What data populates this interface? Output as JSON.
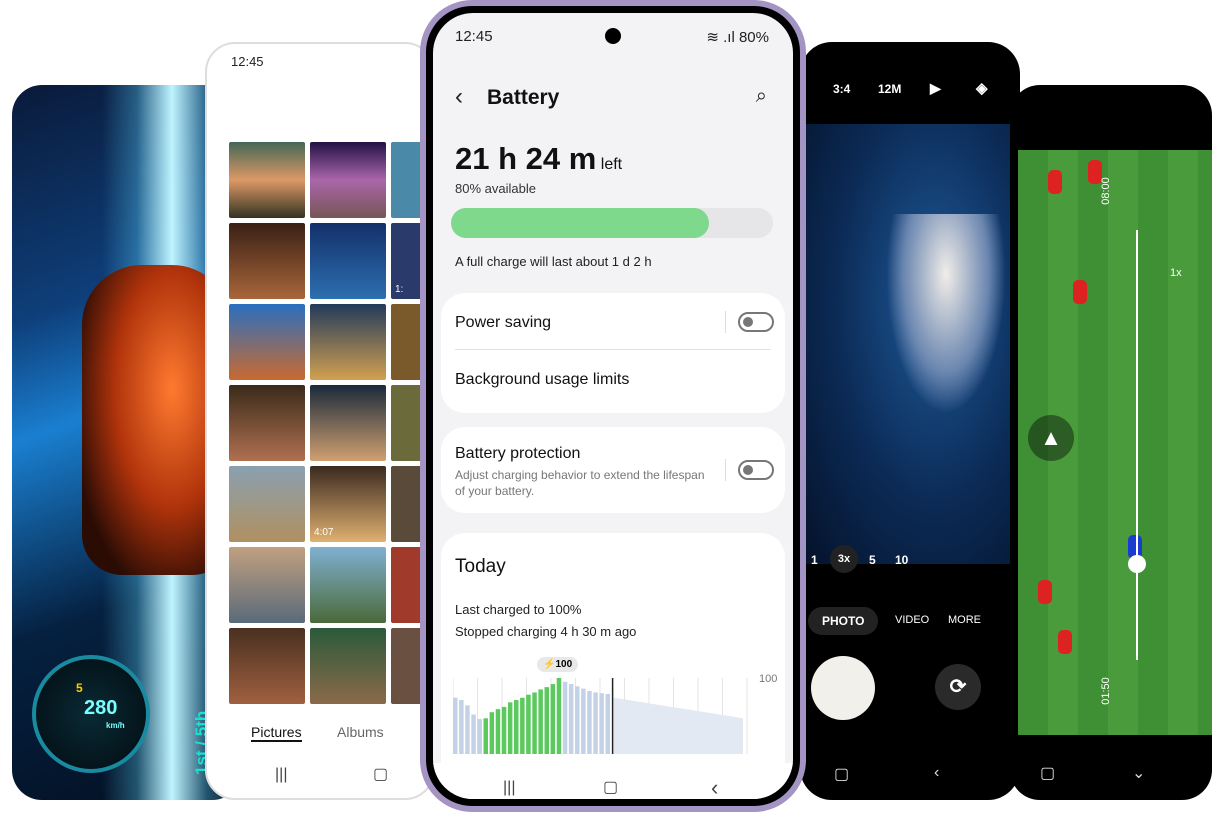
{
  "game": {
    "speed": "280",
    "unit": "km/h",
    "gear": "5",
    "rank": "1st / 5th"
  },
  "gallery": {
    "time": "12:45",
    "videos": [
      "4:07",
      "1:"
    ],
    "tabs": [
      "Pictures",
      "Albums"
    ]
  },
  "battery": {
    "status": {
      "time": "12:45",
      "battery": "80%"
    },
    "title": "Battery",
    "time_left": "21 h 24 m",
    "left_label": "left",
    "available": "80% available",
    "level_percent": 80,
    "full_charge": "A full charge will last about 1 d 2 h",
    "power_saving": "Power saving",
    "background_limits": "Background usage limits",
    "protection_title": "Battery protection",
    "protection_desc": "Adjust charging behavior to extend the lifespan of your battery.",
    "today": "Today",
    "last_charged": "Last charged to 100%",
    "stopped": "Stopped charging 4 h 30 m ago",
    "peak_label": "⚡100",
    "axis_max": "100",
    "colors": {
      "green": "#7ed98c",
      "charging": "#5cc95f",
      "usage": "#c4d2e8"
    }
  },
  "chart_data": {
    "type": "bar",
    "ylim": [
      0,
      100
    ],
    "values": [
      74,
      71,
      64,
      52,
      46,
      47,
      55,
      59,
      62,
      68,
      71,
      74,
      78,
      81,
      85,
      88,
      92,
      100,
      95,
      92,
      89,
      86,
      83,
      81,
      80,
      79
    ],
    "charging": [
      0,
      0,
      0,
      0,
      0,
      1,
      1,
      1,
      1,
      1,
      1,
      1,
      1,
      1,
      1,
      1,
      1,
      1,
      0,
      0,
      0,
      0,
      0,
      0,
      0,
      0
    ],
    "projection": [
      74,
      47
    ]
  },
  "camera": {
    "ratio": "3:4",
    "mp": "12M",
    "zooms": [
      "1",
      "3x",
      "5",
      "10"
    ],
    "modes": [
      "PHOTO",
      "VIDEO",
      "MORE"
    ]
  },
  "sports": {
    "time_top": "08:00",
    "time_bottom": "01:50",
    "zoom": "1x"
  }
}
